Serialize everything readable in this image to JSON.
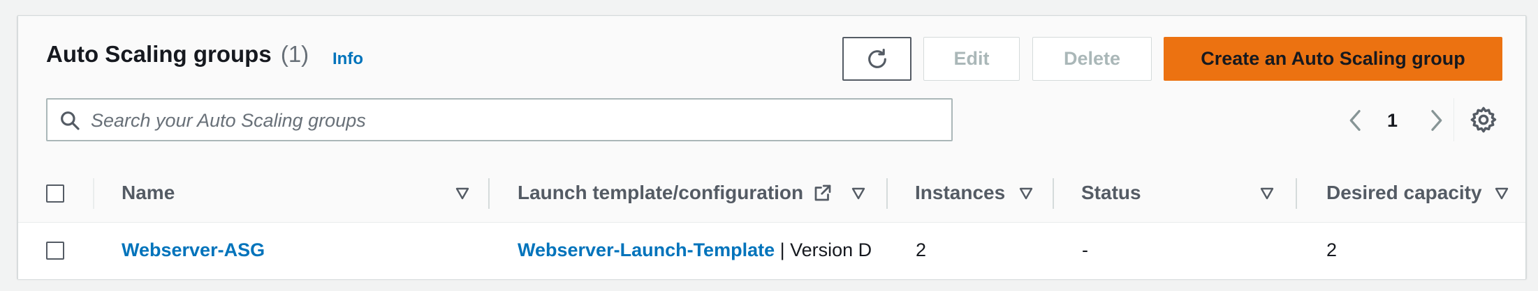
{
  "header": {
    "title": "Auto Scaling groups",
    "count": "(1)",
    "info_label": "Info"
  },
  "toolbar": {
    "refresh_icon": "refresh-icon",
    "edit_label": "Edit",
    "delete_label": "Delete",
    "create_label": "Create an Auto Scaling group",
    "primary_color": "#ec7211"
  },
  "search": {
    "placeholder": "Search your Auto Scaling groups",
    "value": ""
  },
  "pagination": {
    "current_page": "1"
  },
  "table": {
    "columns": [
      {
        "label": "Name"
      },
      {
        "label": "Launch template/configuration"
      },
      {
        "label": "Instances"
      },
      {
        "label": "Status"
      },
      {
        "label": "Desired capacity"
      }
    ],
    "rows": [
      {
        "name": "Webserver-ASG",
        "launch_template": "Webserver-Launch-Template",
        "launch_version": " | Version D",
        "instances": "2",
        "status": "-",
        "desired_capacity": "2"
      }
    ]
  },
  "colors": {
    "link": "#0073bb",
    "text": "#16191f",
    "muted": "#687078"
  }
}
